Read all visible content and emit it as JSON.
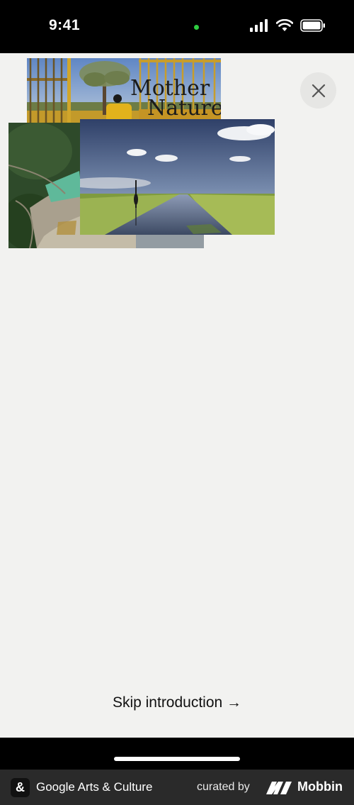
{
  "status_bar": {
    "time": "9:41",
    "icons": [
      "signal-icon",
      "wifi-icon",
      "battery-icon"
    ]
  },
  "intro": {
    "story_title_line1": "Mother",
    "story_title_line2": "Nature",
    "images": [
      "gate-and-tree-photo",
      "aerial-quarry-photo",
      "wetland-channel-photo"
    ]
  },
  "close": {
    "icon": "close-icon"
  },
  "skip": {
    "label": "Skip introduction →"
  },
  "footer": {
    "app_icon_glyph": "&",
    "app_name": "Google Arts & Culture",
    "curated_by": "curated by",
    "brand": "Mobbin"
  },
  "colors": {
    "background": "#f2f2f0",
    "status_dot": "#2ecc40",
    "footer_bg": "#2a2a2a"
  }
}
